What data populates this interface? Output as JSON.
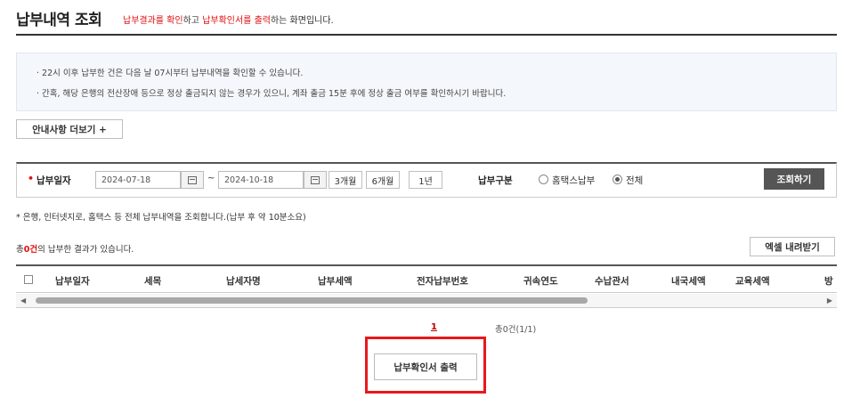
{
  "header": {
    "title": "납부내역 조회",
    "subtitle_part1": "납부결과를 확인",
    "subtitle_part2": "하고 ",
    "subtitle_part3": "납부확인서를 출력",
    "subtitle_part4": "하는 화면입니다."
  },
  "notice": {
    "line1": "· 22시 이후 납부한 건은 다음 날 07시부터 납부내역을 확인할 수 있습니다.",
    "line2": "· 간혹, 해당 은행의 전산장애 등으로 정상 출금되지 않는 경우가 있으니, 계좌 출금 15분 후에 정상 출금 여부를 확인하시기 바랍니다.",
    "more_label": "안내사항 더보기 +"
  },
  "search": {
    "date_label": "납부일자",
    "date_from": "2024-07-18",
    "tilde": "~",
    "date_to": "2024-10-18",
    "quick_3m": "3개월",
    "quick_6m": "6개월",
    "quick_1y": "1년",
    "type_label": "납부구분",
    "radio_hometax": "홈택스납부",
    "radio_all": "전체",
    "search_button": "조회하기"
  },
  "search_note": "* 은행, 인터넷지로, 홈택스 등 전체 납부내역을 조회합니다.(납부 후 약 10분소요)",
  "results": {
    "prefix": "총",
    "count": "0건",
    "suffix": "의 납부한 결과가 있습니다.",
    "excel_button": "엑셀 내려받기"
  },
  "table": {
    "columns": [
      "납부일자",
      "세목",
      "납세자명",
      "납부세액",
      "전자납부번호",
      "귀속연도",
      "수납관서",
      "내국세액",
      "교육세액",
      "방"
    ]
  },
  "pagination": {
    "current_page": "1",
    "summary": "총0건(1/1)"
  },
  "print_button": "납부확인서 출력",
  "colors": {
    "accent_red": "#e01010",
    "highlight_border": "#e8181c",
    "dark_button": "#555555"
  }
}
